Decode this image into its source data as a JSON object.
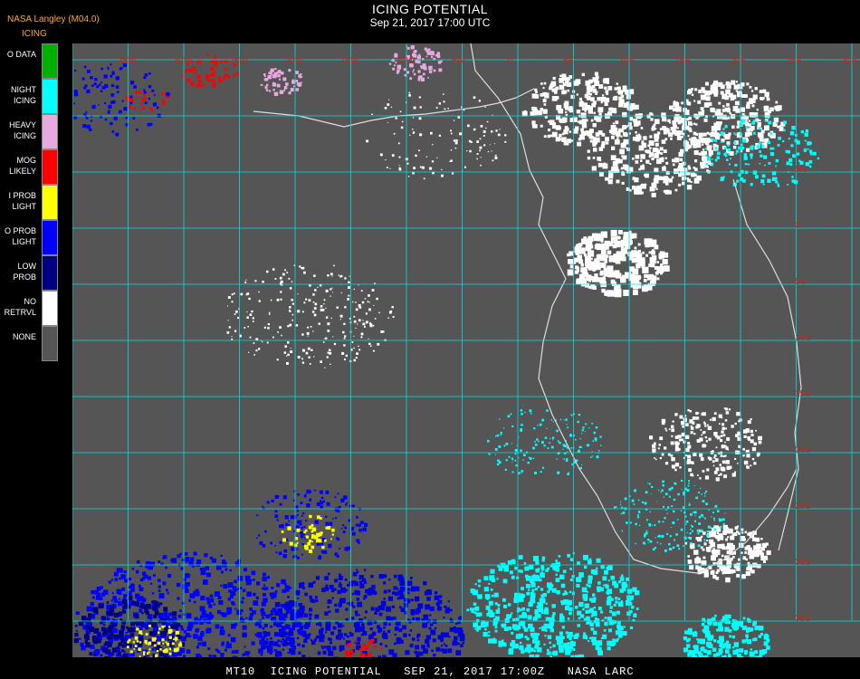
{
  "header": {
    "producer": "NASA Langley (M04.0)",
    "product": "ICING",
    "title": "ICING POTENTIAL",
    "subtitle": "Sep 21, 2017 17:00 UTC"
  },
  "legend": [
    {
      "label": "O DATA",
      "color": "#00b000"
    },
    {
      "label": "NIGHT\nICING",
      "color": "#00ffff"
    },
    {
      "label": "HEAVY\nICING",
      "color": "#e8a8e0"
    },
    {
      "label": "MOG\nLIKELY",
      "color": "#ff0000"
    },
    {
      "label": "I PROB\nLIGHT",
      "color": "#ffff00"
    },
    {
      "label": "O PROB\nLIGHT",
      "color": "#0000ff"
    },
    {
      "label": "LOW\nPROB",
      "color": "#000080"
    },
    {
      "label": "NO\nRETRVL",
      "color": "#ffffff"
    },
    {
      "label": "NONE",
      "color": "#555555"
    }
  ],
  "map": {
    "background_color": "#555555",
    "grid_color": "#00e0e0",
    "label_color": "#cc2222",
    "top_labels": [
      "35W",
      "30W",
      "25W",
      "20W",
      "15W",
      "10W",
      "5W",
      "0",
      "5E",
      "10E",
      "15E",
      "20E",
      "25E",
      "30E",
      "35E"
    ],
    "right_labels": [
      "5N",
      "0",
      "5S",
      "10S",
      "15S",
      "20S",
      "25S",
      "30S",
      "35S",
      "40S"
    ]
  },
  "footer": {
    "text": "MT10  ICING POTENTIAL   SEP 21, 2017 17:00Z   NASA LARC"
  }
}
